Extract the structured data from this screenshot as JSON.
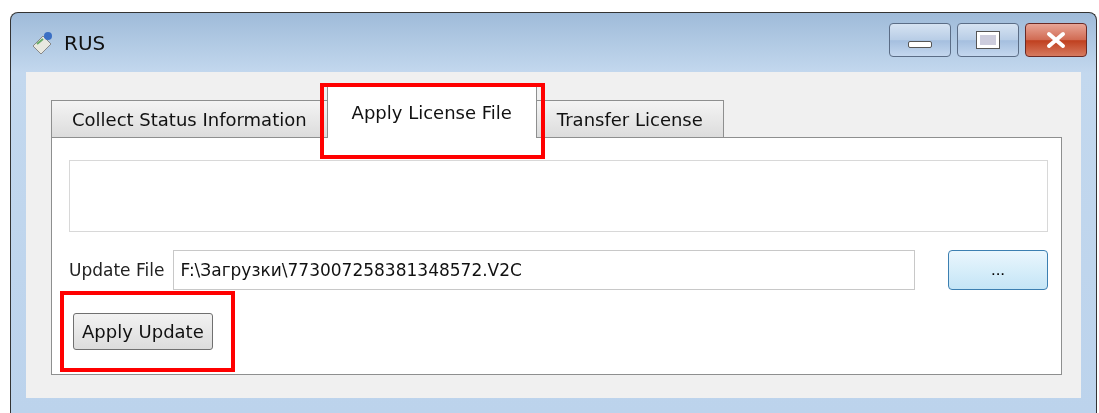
{
  "window": {
    "title": "RUS"
  },
  "tabs": [
    {
      "label": "Collect Status Information",
      "selected": false,
      "highlighted": false
    },
    {
      "label": "Apply License File",
      "selected": true,
      "highlighted": true
    },
    {
      "label": "Transfer License",
      "selected": false,
      "highlighted": false
    }
  ],
  "update_file": {
    "label": "Update File",
    "value": "F:\\Загрузки\\773007258381348572.V2C",
    "browse_button": "..."
  },
  "apply_button": {
    "label": "Apply Update",
    "highlighted": true
  }
}
